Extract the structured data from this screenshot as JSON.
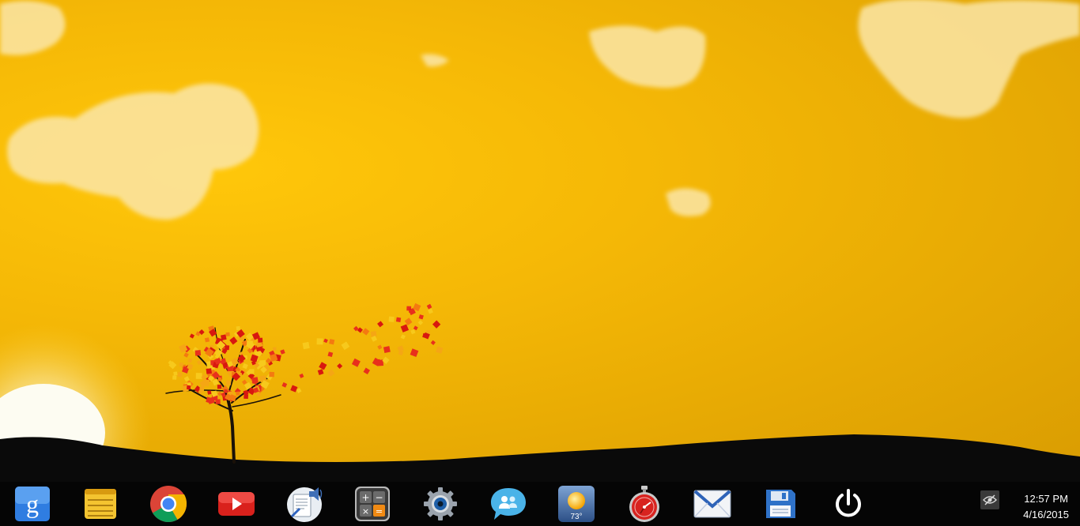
{
  "desktop": {
    "wallpaper": "autumn-tree-sunset",
    "colors": {
      "sky": "#f5b806",
      "ground": "#0a0a0a",
      "cloud": "#fbe6a8"
    }
  },
  "taskbar": {
    "background": "#050505",
    "pinned": [
      {
        "name": "google-search-icon",
        "title": "Google Search"
      },
      {
        "name": "notes-icon",
        "title": "Notes"
      },
      {
        "name": "chrome-icon",
        "title": "Chrome"
      },
      {
        "name": "youtube-icon",
        "title": "YouTube"
      },
      {
        "name": "text-to-speech-icon",
        "title": "Text to Speech"
      },
      {
        "name": "calculator-icon",
        "title": "Calculator"
      },
      {
        "name": "settings-gear-icon",
        "title": "Settings"
      },
      {
        "name": "chat-icon",
        "title": "Chat"
      },
      {
        "name": "weather-icon",
        "title": "Weather",
        "temperature": "73°"
      },
      {
        "name": "stopwatch-icon",
        "title": "Stopwatch"
      },
      {
        "name": "mail-icon",
        "title": "Mail"
      },
      {
        "name": "save-disk-icon",
        "title": "Save"
      },
      {
        "name": "power-icon",
        "title": "Power"
      }
    ]
  },
  "tray": {
    "hidden_icons": "eye-hidden-icon",
    "time": "12:57 PM",
    "date": "4/16/2015"
  }
}
